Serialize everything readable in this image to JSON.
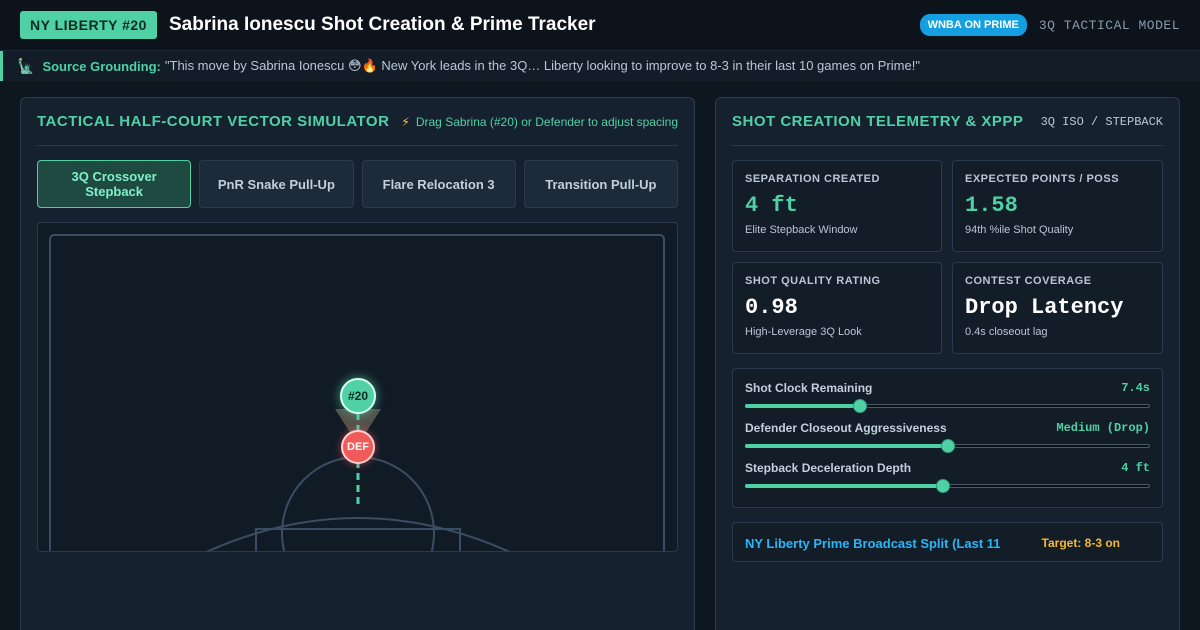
{
  "header": {
    "team_badge": "NY LIBERTY #20",
    "title": "Sabrina Ionescu Shot Creation & Prime Tracker",
    "prime_badge": "WNBA ON PRIME",
    "model_label": "3Q TACTICAL MODEL"
  },
  "grounding": {
    "icon": "statue-of-liberty-icon",
    "label": "Source Grounding:",
    "quote": "\"This move by Sabrina Ionescu 😳🔥 New York leads in the 3Q… Liberty looking to improve to 8-3 in their last 10 games on Prime!\""
  },
  "simulator": {
    "title": "TACTICAL HALF-COURT VECTOR SIMULATOR",
    "hint": "Drag Sabrina (#20) or Defender to adjust spacing",
    "tabs": [
      {
        "label": "3Q Crossover Stepback",
        "active": true
      },
      {
        "label": "PnR Snake Pull-Up",
        "active": false
      },
      {
        "label": "Flare Relocation 3",
        "active": false
      },
      {
        "label": "Transition Pull-Up",
        "active": false
      }
    ],
    "offense_label": "#20",
    "defense_label": "DEF"
  },
  "telemetry": {
    "title": "SHOT CREATION TELEMETRY & XPPP",
    "mode": "3Q ISO / STEPBACK",
    "stats": [
      {
        "label": "Separation Created",
        "value": "4 ft",
        "sub": "Elite Stepback Window",
        "tone": "green"
      },
      {
        "label": "Expected Points / Poss",
        "value": "1.58",
        "sub": "94th %ile Shot Quality",
        "tone": "green"
      },
      {
        "label": "Shot Quality Rating",
        "value": "0.98",
        "sub": "High-Leverage 3Q Look",
        "tone": "white"
      },
      {
        "label": "Contest Coverage",
        "value": "Drop Latency",
        "sub": "0.4s closeout lag",
        "tone": "white"
      }
    ],
    "sliders": [
      {
        "label": "Shot Clock Remaining",
        "value": "7.4s",
        "level": 0.285
      },
      {
        "label": "Defender Closeout Aggressiveness",
        "value": "Medium (Drop)",
        "level": 0.5
      },
      {
        "label": "Stepback Deceleration Depth",
        "value": "4 ft",
        "level": 0.488
      }
    ],
    "split": {
      "title": "NY Liberty Prime Broadcast Split (Last 11",
      "target": "Target: 8-3 on"
    }
  },
  "colors": {
    "accent": "#4fd1a5",
    "prime_blue": "#14a0e0",
    "defender_red": "#f05a5a",
    "target_gold": "#f5b82e"
  }
}
